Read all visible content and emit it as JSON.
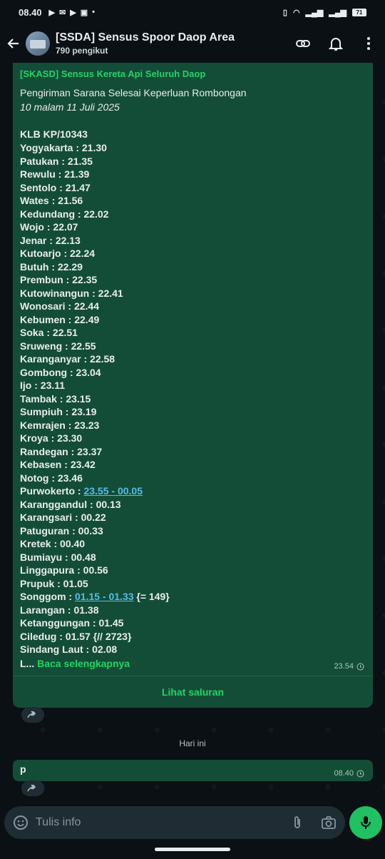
{
  "status_bar": {
    "time": "08.40",
    "battery": "71"
  },
  "header": {
    "title": "[SSDA] Sensus Spoor Daop Area",
    "subtitle": "790 pengikut"
  },
  "post": {
    "channel": "[SKASD] Sensus Kereta Api Seluruh Daop",
    "headline": "Pengiriman Sarana Selesai Keperluan Rombongan",
    "date": "10 malam 11 Juli 2025",
    "train": "KLB KP/10343",
    "stops": [
      {
        "name": "Yogyakarta : ",
        "time": "21.30"
      },
      {
        "name": "Patukan : ",
        "time": "21.35"
      },
      {
        "name": "Rewulu : ",
        "time": "21.39"
      },
      {
        "name": "Sentolo : ",
        "time": "21.47"
      },
      {
        "name": "Wates : ",
        "time": "21.56"
      },
      {
        "name": "Kedundang : ",
        "time": "22.02"
      },
      {
        "name": "Wojo : ",
        "time": "22.07"
      },
      {
        "name": "Jenar : ",
        "time": "22.13"
      },
      {
        "name": "Kutoarjo : ",
        "time": "22.24"
      },
      {
        "name": "Butuh : ",
        "time": "22.29"
      },
      {
        "name": "Prembun : ",
        "time": "22.35"
      },
      {
        "name": "Kutowinangun : ",
        "time": "22.41"
      },
      {
        "name": "Wonosari : ",
        "time": "22.44"
      },
      {
        "name": "Kebumen : ",
        "time": "22.49"
      },
      {
        "name": "Soka : ",
        "time": "22.51"
      },
      {
        "name": "Sruweng : ",
        "time": "22.55"
      },
      {
        "name": "Karanganyar : ",
        "time": "22.58"
      },
      {
        "name": "Gombong : ",
        "time": "23.04"
      },
      {
        "name": "Ijo : ",
        "time": "23.11"
      },
      {
        "name": "Tambak : ",
        "time": "23.15"
      },
      {
        "name": "Sumpiuh : ",
        "time": "23.19"
      },
      {
        "name": "Kemrajen : ",
        "time": "23.23"
      },
      {
        "name": "Kroya : ",
        "time": "23.30"
      },
      {
        "name": "Randegan : ",
        "time": "23.37"
      },
      {
        "name": "Kebasen : ",
        "time": "23.42"
      },
      {
        "name": "Notog : ",
        "time": "23.46"
      },
      {
        "name": "Purwokerto : ",
        "link": "23.55 - 00.05"
      },
      {
        "name": "Karanggandul : ",
        "time": "00.13"
      },
      {
        "name": "Karangsari : ",
        "time": "00.22"
      },
      {
        "name": "Patuguran : ",
        "time": "00.33"
      },
      {
        "name": "Kretek : ",
        "time": "00.40"
      },
      {
        "name": "Bumiayu : ",
        "time": "00.48"
      },
      {
        "name": "Linggapura : ",
        "time": "00.56"
      },
      {
        "name": "Prupuk : ",
        "time": "01.05"
      },
      {
        "name": "Songgom : ",
        "link": "01.15 - 01.33",
        "suffix": " {= 149}"
      },
      {
        "name": "Larangan : ",
        "time": "01.38"
      },
      {
        "name": "Ketanggungan : ",
        "time": "01.45"
      },
      {
        "name": "Ciledug : ",
        "time": "01.57 {// 2723}"
      },
      {
        "name": "Sindang Laut : ",
        "time": "02.08"
      }
    ],
    "truncated": "L...",
    "read_more": "Baca selengkapnya",
    "time": "23.54",
    "view_channel": "Lihat saluran"
  },
  "day_divider": "Hari ini",
  "message2": {
    "text": "p",
    "time": "08.40"
  },
  "composer": {
    "placeholder": "Tulis info"
  },
  "colors": {
    "bubble": "#144d37",
    "accent": "#25d366",
    "link": "#53bdeb",
    "background": "#0b1014"
  }
}
